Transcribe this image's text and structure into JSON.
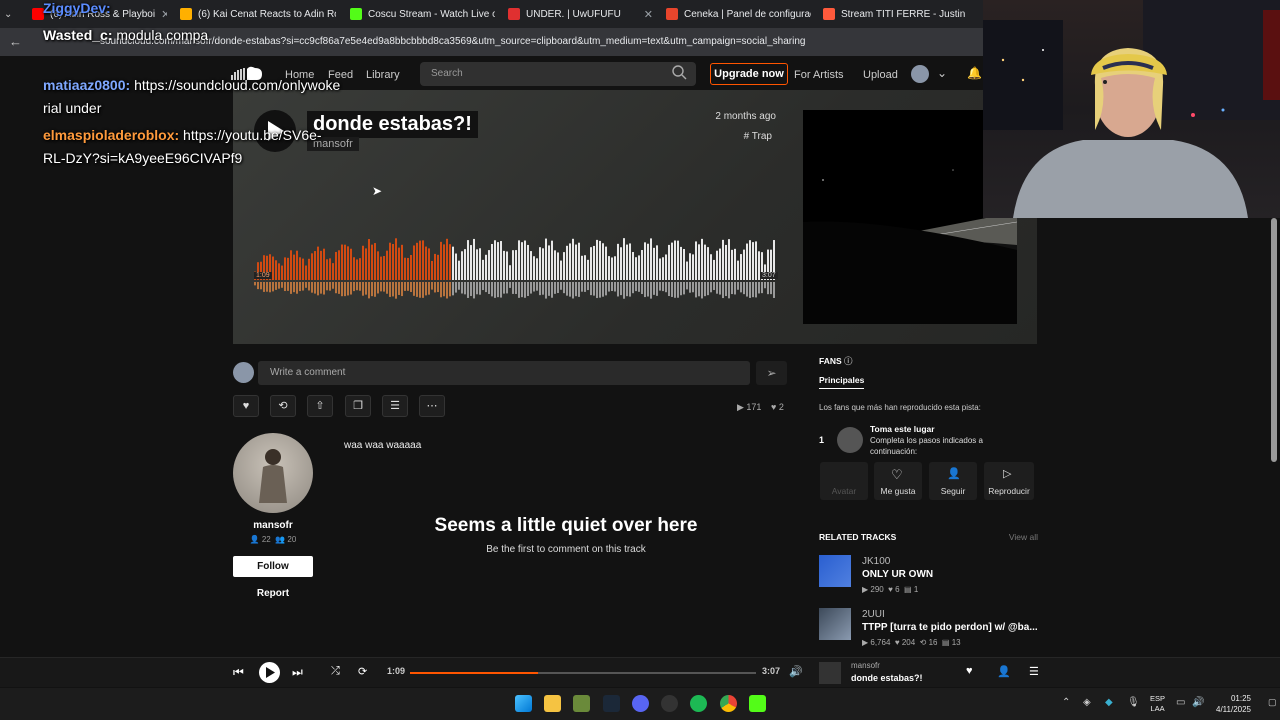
{
  "tabs": [
    {
      "label": "(6) Adin Ross & Playboi",
      "color": "#ff0000"
    },
    {
      "label": "(6) Kai Cenat Reacts to Adin Ro",
      "color": "#ffb000"
    },
    {
      "label": "Coscu Stream - Watch Live on",
      "color": "#53fc18"
    },
    {
      "label": "UNDER. | UwUFUFU",
      "color": "#e03030"
    },
    {
      "label": "Ceneka | Panel de configuració",
      "color": "#e8452c"
    },
    {
      "label": "Stream TITI FERRE - Justin Bieb",
      "color": "#ff5a3c"
    }
  ],
  "url": "soundcloud.com/mansofr/donde-estabas?si=cc9cf86a7e5e4ed9a8bbcbbbd8ca3569&utm_source=clipboard&utm_medium=text&utm_campaign=social_sharing",
  "nav": {
    "home": "Home",
    "feed": "Feed",
    "library": "Library",
    "search_placeholder": "Search",
    "upgrade": "Upgrade now",
    "artists": "For Artists",
    "upload": "Upload"
  },
  "track": {
    "title": "donde estabas?!",
    "artist": "mansofr",
    "age": "2 months ago",
    "tag": "# Trap",
    "current_time": "1:09",
    "total_time": "3:07",
    "progress": 0.37
  },
  "comment": {
    "placeholder": "Write a comment"
  },
  "stats": {
    "plays": "171",
    "likes": "2"
  },
  "uploader": {
    "name": "mansofr",
    "followers": "22",
    "following": "20",
    "follow": "Follow",
    "report": "Report",
    "description": "waa waa waaaaa"
  },
  "empty": {
    "title": "Seems a little quiet over here",
    "subtitle": "Be the first to comment on this track"
  },
  "fans": {
    "heading": "FANS",
    "tab": "Principales",
    "desc": "Los fans que más han reproducido esta pista:",
    "rank": "1",
    "name": "Toma este lugar",
    "detail": "Completa los pasos indicados a continuación:",
    "buttons": [
      "Avatar",
      "Me gusta",
      "Seguir",
      "Reproducir"
    ]
  },
  "related": {
    "heading": "RELATED TRACKS",
    "view_all": "View all",
    "items": [
      {
        "artist": "JK100",
        "title": "ONLY UR OWN",
        "plays": "290",
        "likes": "6",
        "reposts": "",
        "comments": "1"
      },
      {
        "artist": "2UUI",
        "title": "TTPP [turra te pido perdon] w/ @ba...",
        "plays": "6,764",
        "likes": "204",
        "reposts": "16",
        "comments": "13"
      }
    ]
  },
  "player": {
    "current": "1:09",
    "total": "3:07",
    "artist": "mansofr",
    "title": "donde estabas?!",
    "progress": 0.37
  },
  "chat": [
    {
      "user": "ZiggyDev:",
      "text": "",
      "color": "#5b8cff"
    },
    {
      "user": "Wasted_c:",
      "text": "modula compa",
      "color": "#ffffff"
    },
    {
      "user": "matiaaz0800:",
      "text": "https://soundcloud.com/onlywoke",
      "color": "#7fa8ff"
    },
    {
      "user": "",
      "text": "rial under",
      "color": "#ffffff"
    },
    {
      "user": "elmaspioladeroblox:",
      "text": "https://youtu.be/SV6e-",
      "color": "#ff9a3c"
    },
    {
      "user": "",
      "text": "RL-DzY?si=kA9yeeE96CIVAPf9",
      "color": "#ffffff"
    }
  ],
  "taskbar": {
    "lang1": "ESP",
    "lang2": "LAA",
    "time": "01:25",
    "date": "4/11/2025"
  },
  "colors": {
    "accent": "#ff5500",
    "bg": "#121212"
  }
}
